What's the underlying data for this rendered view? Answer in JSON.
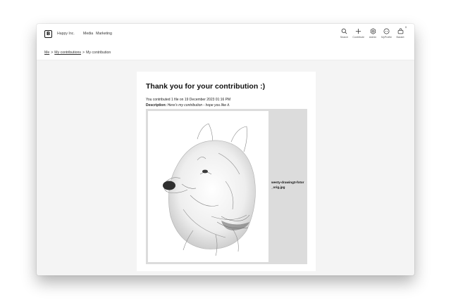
{
  "header": {
    "logo_letter": "B",
    "company_name": "Happy Inc.",
    "nav": [
      "Media",
      "Marketing"
    ],
    "actions": [
      {
        "label": "Search",
        "icon": "search-icon"
      },
      {
        "label": "Contribute",
        "icon": "plus-icon"
      },
      {
        "label": "Admin",
        "icon": "gear-icon"
      },
      {
        "label": "MyProfile",
        "icon": "profile-icon"
      },
      {
        "label": "Basket",
        "icon": "basket-icon"
      }
    ],
    "basket_count": "0"
  },
  "breadcrumb": {
    "items": [
      "Me",
      "My contributions",
      "My contribution"
    ],
    "separator": ">"
  },
  "content": {
    "title": "Thank you for your contribution :)",
    "summary": "You contributed 1 file on 19 December 2023 01:16 PM",
    "description_label": "Description:",
    "description_text": "Here's my contribution - hope you like it.",
    "file": {
      "name": "westy-drawing3-fotor_orig.jpg"
    }
  },
  "colors": {
    "page_background": "#f4f4f4",
    "panel_background": "#dcdcdc",
    "text": "#1a1a1a"
  }
}
